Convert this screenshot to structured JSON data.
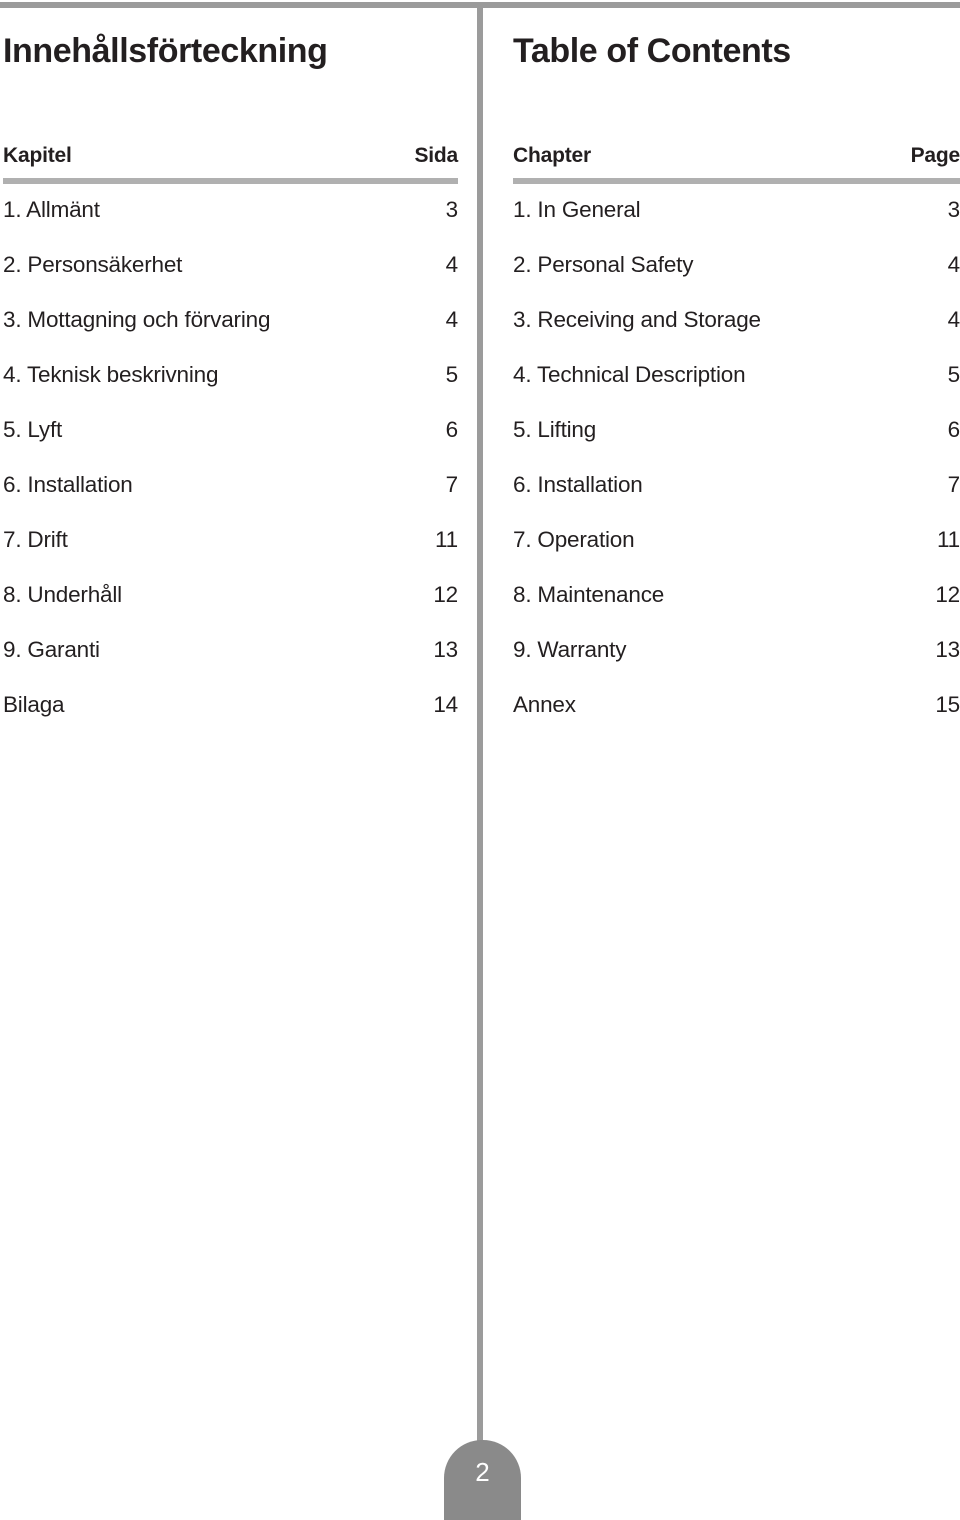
{
  "document": {
    "page_number": "2",
    "accent_gray": "#9b9b9b",
    "rule_gray": "#b0b0b0",
    "tab_gray": "#8a8a8a",
    "text_color": "#231f20"
  },
  "columns": {
    "left": {
      "title": "Innehållsförteckning",
      "header": {
        "chapter": "Kapitel",
        "page": "Sida"
      },
      "rows": [
        {
          "label": "1. Allmänt",
          "page": "3"
        },
        {
          "label": "2. Personsäkerhet",
          "page": "4"
        },
        {
          "label": "3. Mottagning och förvaring",
          "page": "4"
        },
        {
          "label": "4. Teknisk beskrivning",
          "page": "5"
        },
        {
          "label": "5. Lyft",
          "page": "6"
        },
        {
          "label": "6. Installation",
          "page": "7"
        },
        {
          "label": "7. Drift",
          "page": "11"
        },
        {
          "label": "8. Underhåll",
          "page": "12"
        },
        {
          "label": "9. Garanti",
          "page": "13"
        },
        {
          "label": "Bilaga",
          "page": "14"
        }
      ]
    },
    "right": {
      "title": "Table of Contents",
      "header": {
        "chapter": "Chapter",
        "page": "Page"
      },
      "rows": [
        {
          "label": "1. In General",
          "page": "3"
        },
        {
          "label": "2. Personal Safety",
          "page": "4"
        },
        {
          "label": "3. Receiving and Storage",
          "page": "4"
        },
        {
          "label": "4. Technical Description",
          "page": "5"
        },
        {
          "label": "5. Lifting",
          "page": "6"
        },
        {
          "label": "6. Installation",
          "page": "7"
        },
        {
          "label": "7. Operation",
          "page": "11"
        },
        {
          "label": "8. Maintenance",
          "page": "12"
        },
        {
          "label": "9. Warranty",
          "page": "13"
        },
        {
          "label": "Annex",
          "page": "15"
        }
      ]
    }
  }
}
